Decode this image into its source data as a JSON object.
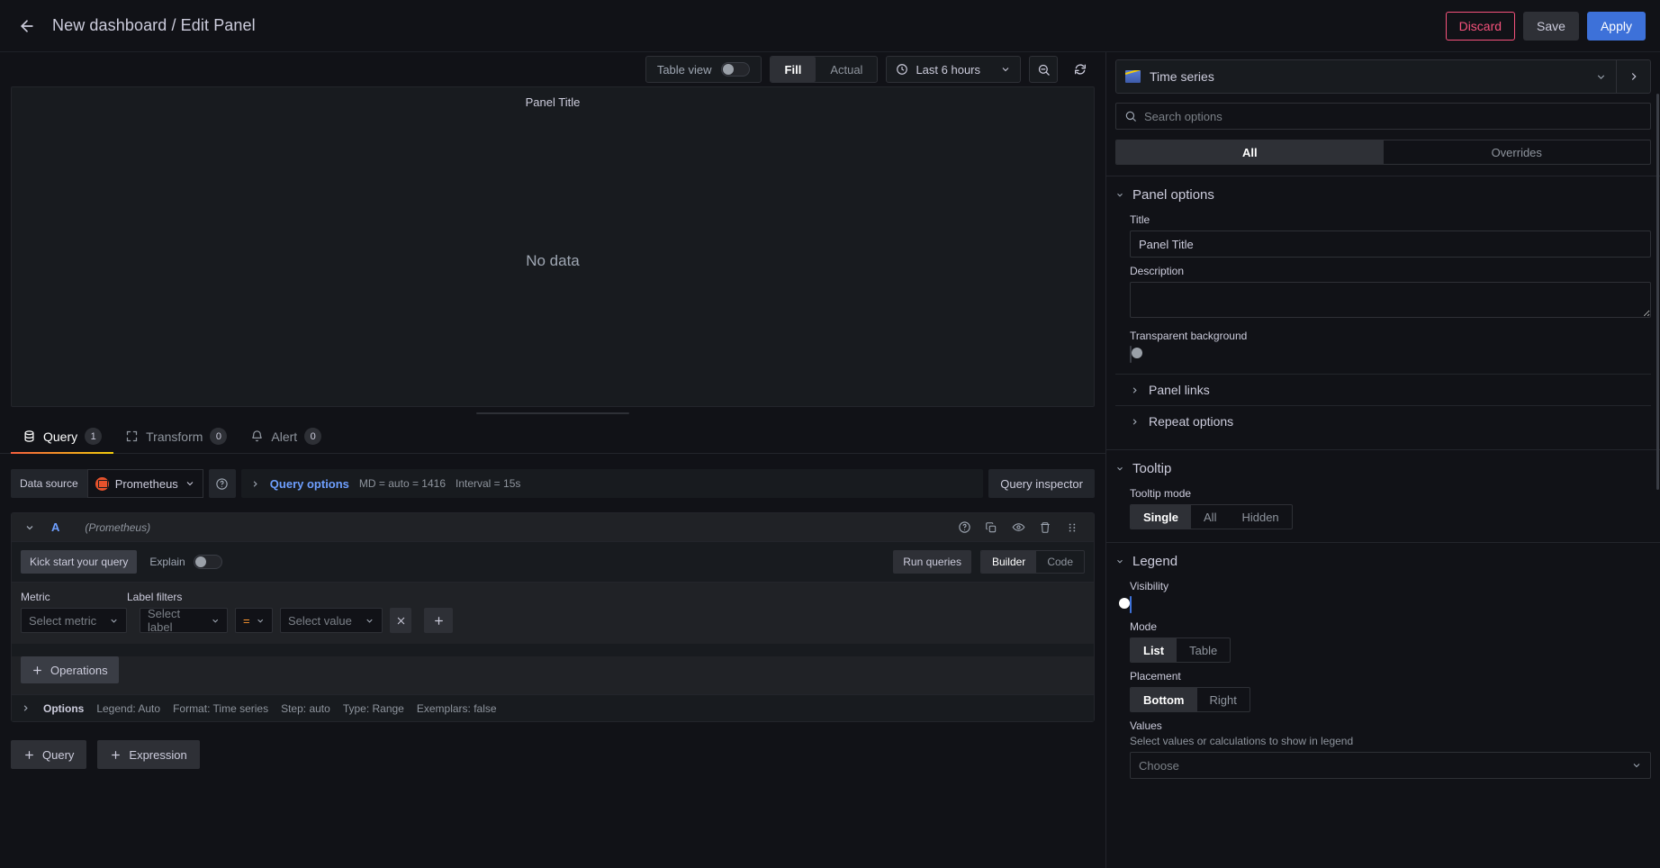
{
  "topbar": {
    "back_icon": "arrow-left-icon",
    "breadcrumb": "New dashboard / Edit Panel",
    "discard_label": "Discard",
    "save_label": "Save",
    "apply_label": "Apply",
    "accent_discard": "#f5527c",
    "accent_apply": "#3d71d9"
  },
  "viz_toolbar": {
    "table_view_label": "Table view",
    "table_view_on": false,
    "fill_label": "Fill",
    "actual_label": "Actual",
    "fill_active": true,
    "clock_icon": "clock-icon",
    "time_range": "Last 6 hours",
    "time_chevron_icon": "chevron-down-icon",
    "zoom_out_icon": "zoom-out-icon",
    "refresh_icon": "refresh-icon"
  },
  "panel": {
    "title": "Panel Title",
    "no_data": "No data"
  },
  "query_tabs": [
    {
      "label": "Query",
      "count": "1",
      "icon": "database-icon",
      "active": true
    },
    {
      "label": "Transform",
      "count": "0",
      "icon": "transform-icon",
      "active": false
    },
    {
      "label": "Alert",
      "count": "0",
      "icon": "bell-icon",
      "active": false
    }
  ],
  "datasource_row": {
    "label": "Data source",
    "name": "Prometheus",
    "logo_icon": "prometheus-logo-icon",
    "chevron_icon": "chevron-down-icon",
    "help_icon": "question-circle-icon",
    "query_options_label": "Query options",
    "options_chevron_icon": "chevron-right-icon",
    "md_meta": "MD = auto = 1416",
    "interval_meta": "Interval = 15s",
    "query_inspector_label": "Query inspector"
  },
  "query_card": {
    "collapse_icon": "chevron-down-icon",
    "ref_id": "A",
    "datasource_note": "(Prometheus)",
    "head_icons": [
      "help-circle-icon",
      "duplicate-icon",
      "eye-icon",
      "trash-icon",
      "drag-handle-icon"
    ],
    "kick_start_label": "Kick start your query",
    "explain_label": "Explain",
    "explain_on": false,
    "run_queries_label": "Run queries",
    "builder_label": "Builder",
    "code_label": "Code",
    "builder_active": true,
    "metric_label": "Metric",
    "label_filters_label": "Label filters",
    "select_metric_placeholder": "Select metric",
    "select_label_placeholder": "Select label",
    "operator_value": "=",
    "select_value_placeholder": "Select value",
    "remove_filter_icon": "close-icon",
    "add_filter_icon": "plus-icon",
    "operations_label": "Operations",
    "operations_icon": "plus-icon",
    "options_summary": {
      "chevron_icon": "chevron-right-icon",
      "title": "Options",
      "items": [
        "Legend: Auto",
        "Format: Time series",
        "Step: auto",
        "Type: Range",
        "Exemplars: false"
      ]
    }
  },
  "add_row": {
    "query_label": "Query",
    "expression_label": "Expression",
    "plus_icon": "plus-icon"
  },
  "options_pane": {
    "viz_picker": {
      "icon": "time-series-viz-icon",
      "name": "Time series",
      "chevron_icon": "chevron-down-icon",
      "next_icon": "chevron-right-icon"
    },
    "search": {
      "icon": "search-icon",
      "placeholder": "Search options",
      "value": ""
    },
    "tabs": {
      "all_label": "All",
      "overrides_label": "Overrides",
      "active": "All"
    },
    "panel_options": {
      "section_title": "Panel options",
      "title_label": "Title",
      "title_value": "Panel Title",
      "description_label": "Description",
      "description_value": "",
      "transparent_label": "Transparent background",
      "transparent_on": false,
      "panel_links_label": "Panel links",
      "repeat_options_label": "Repeat options"
    },
    "tooltip": {
      "section_title": "Tooltip",
      "mode_label": "Tooltip mode",
      "modes": [
        "Single",
        "All",
        "Hidden"
      ],
      "mode_active": "Single"
    },
    "legend": {
      "section_title": "Legend",
      "visibility_label": "Visibility",
      "visibility_on": true,
      "mode_label": "Mode",
      "modes": [
        "List",
        "Table"
      ],
      "mode_active": "List",
      "placement_label": "Placement",
      "placements": [
        "Bottom",
        "Right"
      ],
      "placement_active": "Bottom",
      "values_label": "Values",
      "values_desc": "Select values or calculations to show in legend",
      "values_placeholder": "Choose",
      "values_chevron_icon": "chevron-down-icon"
    }
  }
}
